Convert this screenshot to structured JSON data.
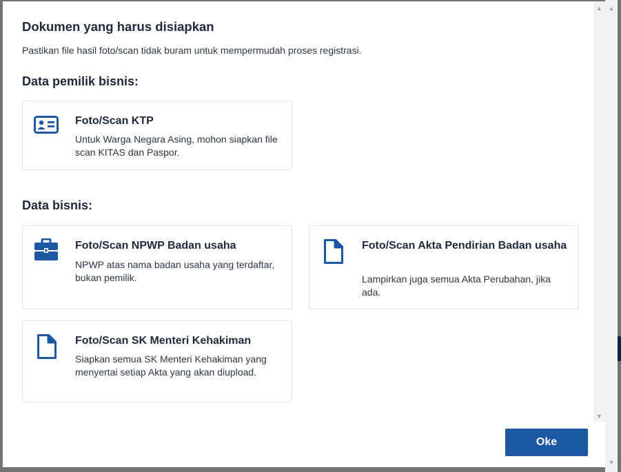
{
  "dialog": {
    "title": "Dokumen yang harus disiapkan",
    "subtitle": "Pastikan file hasil foto/scan tidak buram untuk mempermudah proses registrasi.",
    "ok_label": "Oke"
  },
  "sections": {
    "owner": {
      "heading": "Data pemilik bisnis:",
      "ktp": {
        "title": "Foto/Scan KTP",
        "desc": "Untuk Warga Negara Asing, mohon siapkan file scan KITAS dan Paspor.",
        "icon": "id-card-icon"
      }
    },
    "business": {
      "heading": "Data bisnis:",
      "npwp": {
        "title": "Foto/Scan NPWP Badan usaha",
        "desc": "NPWP atas nama badan usaha yang terdaftar, bukan pemilik.",
        "icon": "briefcase-icon"
      },
      "akta": {
        "title": "Foto/Scan Akta Pendirian Badan usaha",
        "desc": "Lampirkan juga semua Akta Perubahan, jika ada.",
        "icon": "document-icon"
      },
      "sk": {
        "title": "Foto/Scan SK Menteri Kehakiman",
        "desc": "Siapkan semua SK Menteri Kehakiman yang menyertai setiap Akta yang akan diupload.",
        "icon": "document-icon"
      }
    }
  },
  "colors": {
    "accent": "#1b57a3",
    "text": "#1e2a3b",
    "border": "#e3e6ea"
  }
}
